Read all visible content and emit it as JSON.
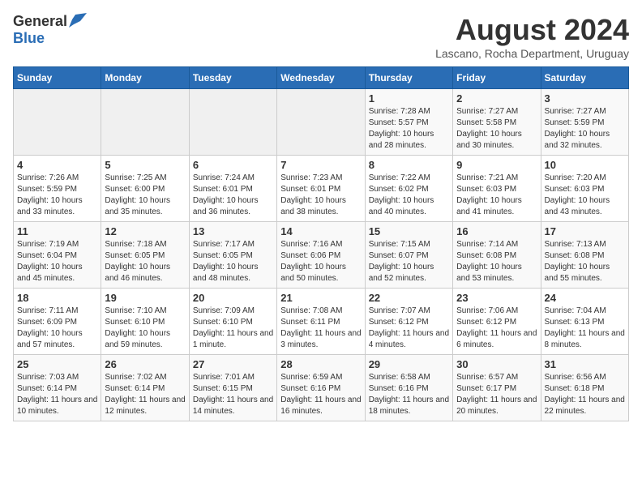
{
  "header": {
    "logo_general": "General",
    "logo_blue": "Blue",
    "month_year": "August 2024",
    "location": "Lascano, Rocha Department, Uruguay"
  },
  "weekdays": [
    "Sunday",
    "Monday",
    "Tuesday",
    "Wednesday",
    "Thursday",
    "Friday",
    "Saturday"
  ],
  "weeks": [
    [
      {
        "day": "",
        "sunrise": "",
        "sunset": "",
        "daylight": ""
      },
      {
        "day": "",
        "sunrise": "",
        "sunset": "",
        "daylight": ""
      },
      {
        "day": "",
        "sunrise": "",
        "sunset": "",
        "daylight": ""
      },
      {
        "day": "",
        "sunrise": "",
        "sunset": "",
        "daylight": ""
      },
      {
        "day": "1",
        "sunrise": "Sunrise: 7:28 AM",
        "sunset": "Sunset: 5:57 PM",
        "daylight": "Daylight: 10 hours and 28 minutes."
      },
      {
        "day": "2",
        "sunrise": "Sunrise: 7:27 AM",
        "sunset": "Sunset: 5:58 PM",
        "daylight": "Daylight: 10 hours and 30 minutes."
      },
      {
        "day": "3",
        "sunrise": "Sunrise: 7:27 AM",
        "sunset": "Sunset: 5:59 PM",
        "daylight": "Daylight: 10 hours and 32 minutes."
      }
    ],
    [
      {
        "day": "4",
        "sunrise": "Sunrise: 7:26 AM",
        "sunset": "Sunset: 5:59 PM",
        "daylight": "Daylight: 10 hours and 33 minutes."
      },
      {
        "day": "5",
        "sunrise": "Sunrise: 7:25 AM",
        "sunset": "Sunset: 6:00 PM",
        "daylight": "Daylight: 10 hours and 35 minutes."
      },
      {
        "day": "6",
        "sunrise": "Sunrise: 7:24 AM",
        "sunset": "Sunset: 6:01 PM",
        "daylight": "Daylight: 10 hours and 36 minutes."
      },
      {
        "day": "7",
        "sunrise": "Sunrise: 7:23 AM",
        "sunset": "Sunset: 6:01 PM",
        "daylight": "Daylight: 10 hours and 38 minutes."
      },
      {
        "day": "8",
        "sunrise": "Sunrise: 7:22 AM",
        "sunset": "Sunset: 6:02 PM",
        "daylight": "Daylight: 10 hours and 40 minutes."
      },
      {
        "day": "9",
        "sunrise": "Sunrise: 7:21 AM",
        "sunset": "Sunset: 6:03 PM",
        "daylight": "Daylight: 10 hours and 41 minutes."
      },
      {
        "day": "10",
        "sunrise": "Sunrise: 7:20 AM",
        "sunset": "Sunset: 6:03 PM",
        "daylight": "Daylight: 10 hours and 43 minutes."
      }
    ],
    [
      {
        "day": "11",
        "sunrise": "Sunrise: 7:19 AM",
        "sunset": "Sunset: 6:04 PM",
        "daylight": "Daylight: 10 hours and 45 minutes."
      },
      {
        "day": "12",
        "sunrise": "Sunrise: 7:18 AM",
        "sunset": "Sunset: 6:05 PM",
        "daylight": "Daylight: 10 hours and 46 minutes."
      },
      {
        "day": "13",
        "sunrise": "Sunrise: 7:17 AM",
        "sunset": "Sunset: 6:05 PM",
        "daylight": "Daylight: 10 hours and 48 minutes."
      },
      {
        "day": "14",
        "sunrise": "Sunrise: 7:16 AM",
        "sunset": "Sunset: 6:06 PM",
        "daylight": "Daylight: 10 hours and 50 minutes."
      },
      {
        "day": "15",
        "sunrise": "Sunrise: 7:15 AM",
        "sunset": "Sunset: 6:07 PM",
        "daylight": "Daylight: 10 hours and 52 minutes."
      },
      {
        "day": "16",
        "sunrise": "Sunrise: 7:14 AM",
        "sunset": "Sunset: 6:08 PM",
        "daylight": "Daylight: 10 hours and 53 minutes."
      },
      {
        "day": "17",
        "sunrise": "Sunrise: 7:13 AM",
        "sunset": "Sunset: 6:08 PM",
        "daylight": "Daylight: 10 hours and 55 minutes."
      }
    ],
    [
      {
        "day": "18",
        "sunrise": "Sunrise: 7:11 AM",
        "sunset": "Sunset: 6:09 PM",
        "daylight": "Daylight: 10 hours and 57 minutes."
      },
      {
        "day": "19",
        "sunrise": "Sunrise: 7:10 AM",
        "sunset": "Sunset: 6:10 PM",
        "daylight": "Daylight: 10 hours and 59 minutes."
      },
      {
        "day": "20",
        "sunrise": "Sunrise: 7:09 AM",
        "sunset": "Sunset: 6:10 PM",
        "daylight": "Daylight: 11 hours and 1 minute."
      },
      {
        "day": "21",
        "sunrise": "Sunrise: 7:08 AM",
        "sunset": "Sunset: 6:11 PM",
        "daylight": "Daylight: 11 hours and 3 minutes."
      },
      {
        "day": "22",
        "sunrise": "Sunrise: 7:07 AM",
        "sunset": "Sunset: 6:12 PM",
        "daylight": "Daylight: 11 hours and 4 minutes."
      },
      {
        "day": "23",
        "sunrise": "Sunrise: 7:06 AM",
        "sunset": "Sunset: 6:12 PM",
        "daylight": "Daylight: 11 hours and 6 minutes."
      },
      {
        "day": "24",
        "sunrise": "Sunrise: 7:04 AM",
        "sunset": "Sunset: 6:13 PM",
        "daylight": "Daylight: 11 hours and 8 minutes."
      }
    ],
    [
      {
        "day": "25",
        "sunrise": "Sunrise: 7:03 AM",
        "sunset": "Sunset: 6:14 PM",
        "daylight": "Daylight: 11 hours and 10 minutes."
      },
      {
        "day": "26",
        "sunrise": "Sunrise: 7:02 AM",
        "sunset": "Sunset: 6:14 PM",
        "daylight": "Daylight: 11 hours and 12 minutes."
      },
      {
        "day": "27",
        "sunrise": "Sunrise: 7:01 AM",
        "sunset": "Sunset: 6:15 PM",
        "daylight": "Daylight: 11 hours and 14 minutes."
      },
      {
        "day": "28",
        "sunrise": "Sunrise: 6:59 AM",
        "sunset": "Sunset: 6:16 PM",
        "daylight": "Daylight: 11 hours and 16 minutes."
      },
      {
        "day": "29",
        "sunrise": "Sunrise: 6:58 AM",
        "sunset": "Sunset: 6:16 PM",
        "daylight": "Daylight: 11 hours and 18 minutes."
      },
      {
        "day": "30",
        "sunrise": "Sunrise: 6:57 AM",
        "sunset": "Sunset: 6:17 PM",
        "daylight": "Daylight: 11 hours and 20 minutes."
      },
      {
        "day": "31",
        "sunrise": "Sunrise: 6:56 AM",
        "sunset": "Sunset: 6:18 PM",
        "daylight": "Daylight: 11 hours and 22 minutes."
      }
    ]
  ]
}
